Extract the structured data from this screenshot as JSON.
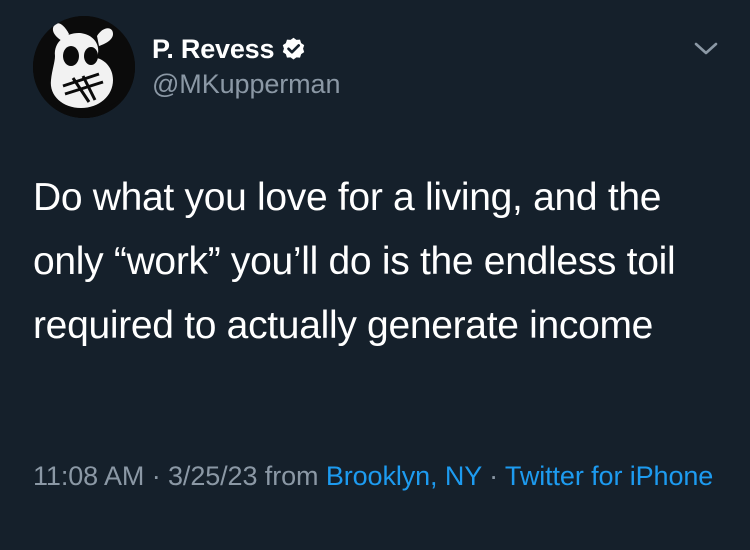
{
  "tweet": {
    "author": {
      "display_name": "P. Revess",
      "handle": "@MKupperman",
      "verified": true,
      "avatar_icon": "cartoon-character-avatar"
    },
    "menu_icon": "chevron-down-icon",
    "body": "Do what you love for a living, and the only “work” you’ll do is the endless toil required to actually generate income",
    "meta": {
      "time": "11:08 AM",
      "separator": "·",
      "date": "3/25/23",
      "from_text": "from",
      "location": "Brooklyn, NY",
      "source": "Twitter for iPhone"
    }
  },
  "colors": {
    "background": "#15202b",
    "text_primary": "#ffffff",
    "text_secondary": "#8b98a5",
    "link": "#1d9bf0"
  }
}
